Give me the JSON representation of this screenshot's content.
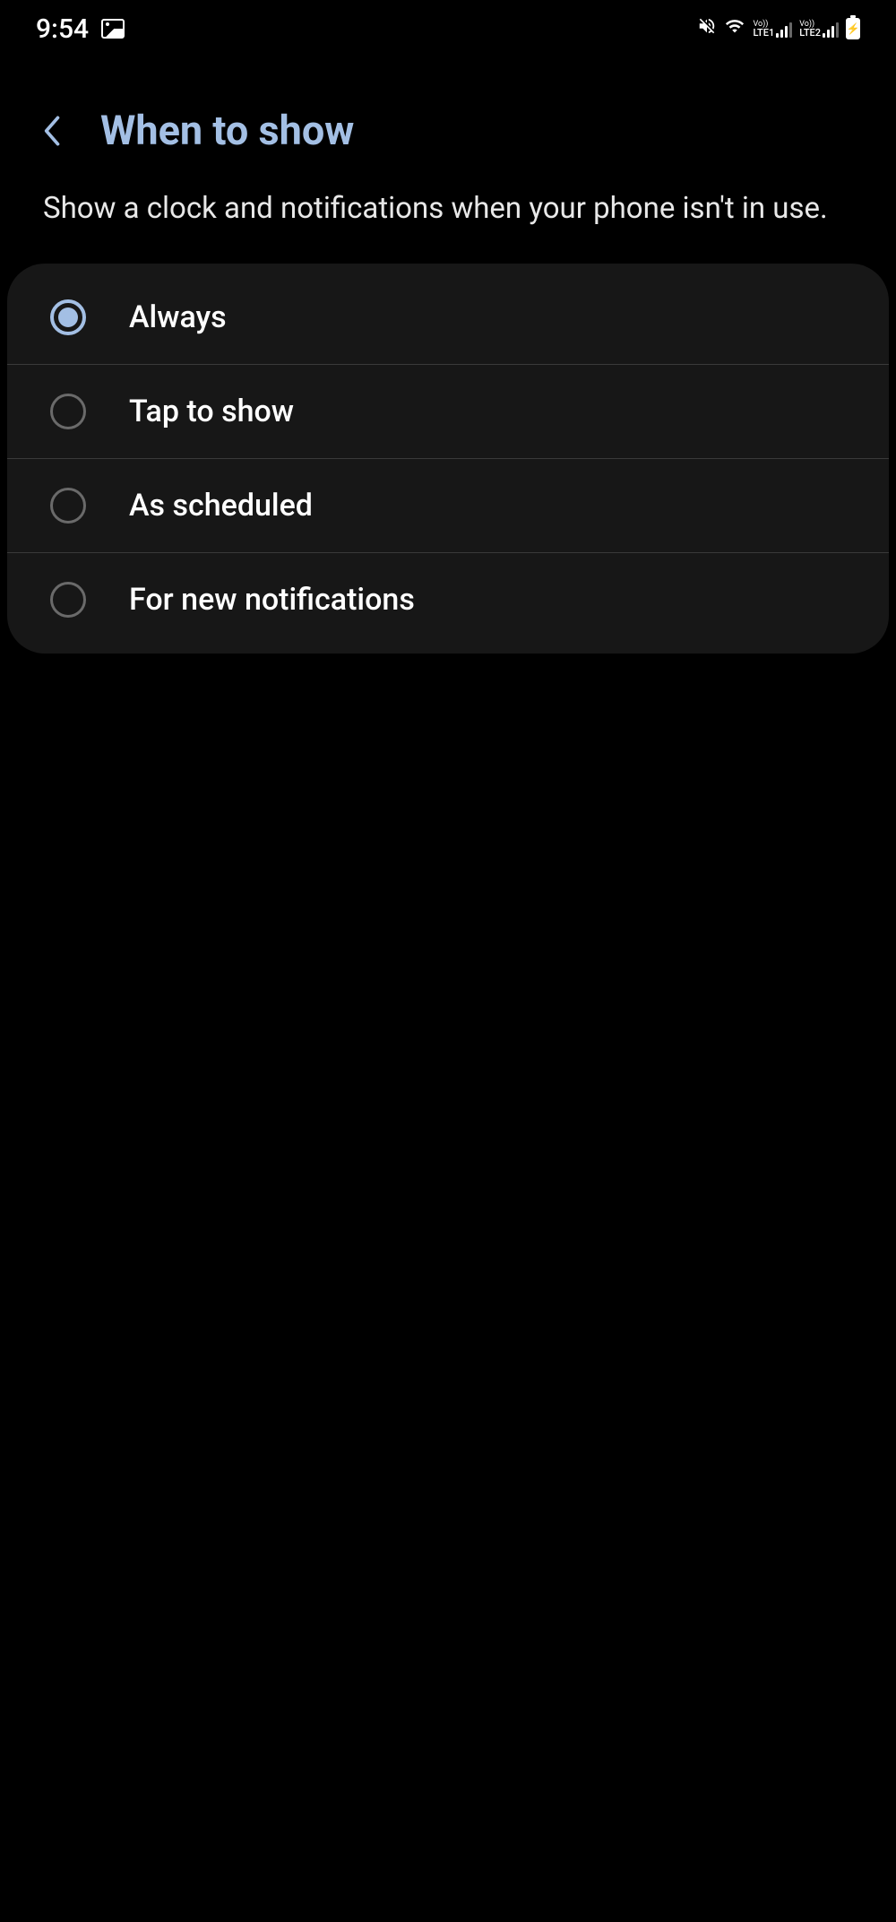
{
  "status_bar": {
    "time": "9:54",
    "lte1": "LTE1",
    "lte2": "LTE2",
    "vo": "Vo))"
  },
  "header": {
    "title": "When to show"
  },
  "description": "Show a clock and notifications when your phone isn't in use.",
  "options": [
    {
      "label": "Always",
      "selected": true
    },
    {
      "label": "Tap to show",
      "selected": false
    },
    {
      "label": "As scheduled",
      "selected": false
    },
    {
      "label": "For new notifications",
      "selected": false
    }
  ]
}
